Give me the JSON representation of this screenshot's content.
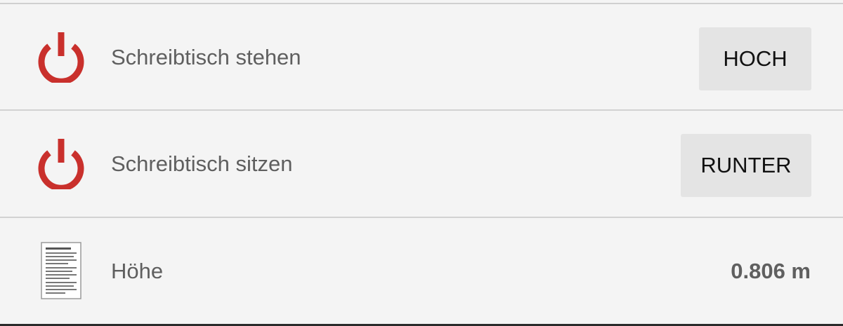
{
  "rows": [
    {
      "icon": "power-icon",
      "label": "Schreibtisch stehen",
      "button_label": "HOCH"
    },
    {
      "icon": "power-icon",
      "label": "Schreibtisch sitzen",
      "button_label": "RUNTER"
    },
    {
      "icon": "document-icon",
      "label": "Höhe",
      "value": "0.806 m"
    }
  ],
  "colors": {
    "power_icon": "#c9302c",
    "background": "#f4f4f4",
    "button_bg": "#e4e4e4"
  }
}
